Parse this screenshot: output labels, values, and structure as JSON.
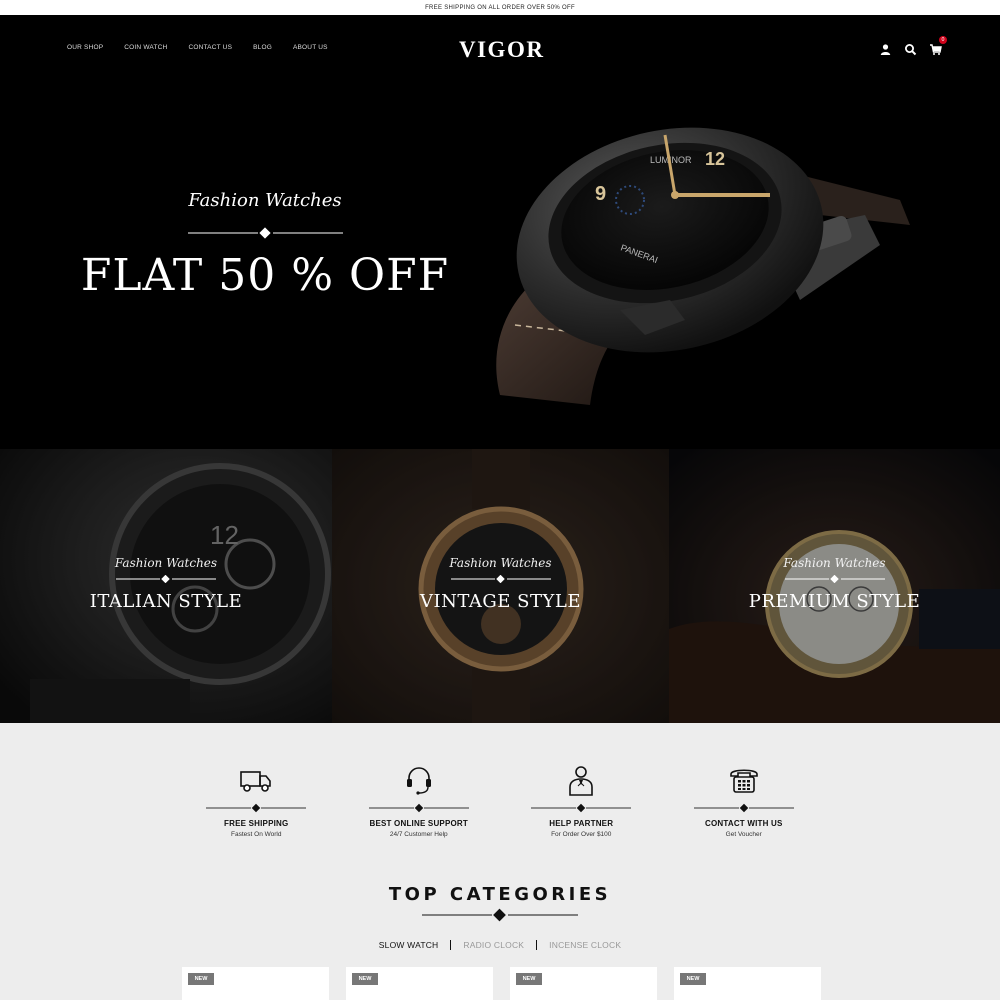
{
  "topbar": {
    "text": "FREE SHIPPING ON ALL ORDER OVER 50% OFF"
  },
  "header": {
    "nav": [
      "OUR SHOP",
      "COIN WATCH",
      "CONTACT US",
      "BLOG",
      "ABOUT US"
    ],
    "logo": "VIGOR",
    "cart_count": "0"
  },
  "hero": {
    "subtitle": "Fashion Watches",
    "title": "FLAT 50 % OFF"
  },
  "banners": [
    {
      "subtitle": "Fashion Watches",
      "title": "ITALIAN STYLE"
    },
    {
      "subtitle": "Fashion Watches",
      "title": "VINTAGE STYLE"
    },
    {
      "subtitle": "Fashion Watches",
      "title": "PREMIUM STYLE"
    }
  ],
  "features": [
    {
      "icon": "truck-icon",
      "title": "FREE SHIPPING",
      "subtitle": "Fastest On World"
    },
    {
      "icon": "headset-icon",
      "title": "BEST ONLINE SUPPORT",
      "subtitle": "24/7 Customer Help"
    },
    {
      "icon": "partner-icon",
      "title": "HELP PARTNER",
      "subtitle": "For Order Over $100"
    },
    {
      "icon": "telephone-icon",
      "title": "CONTACT WITH US",
      "subtitle": "Get Voucher"
    }
  ],
  "categories": {
    "title": "TOP CATEGORIES",
    "tabs": [
      "SLOW WATCH",
      "RADIO CLOCK",
      "INCENSE CLOCK"
    ],
    "active_tab": "SLOW WATCH"
  },
  "products": [
    {
      "badge": "NEW"
    },
    {
      "badge": "NEW"
    },
    {
      "badge": "NEW"
    },
    {
      "badge": "NEW"
    }
  ],
  "colors": {
    "accent": "#d0021b",
    "hero_bg": "#000000",
    "page_bg": "#ededed"
  }
}
